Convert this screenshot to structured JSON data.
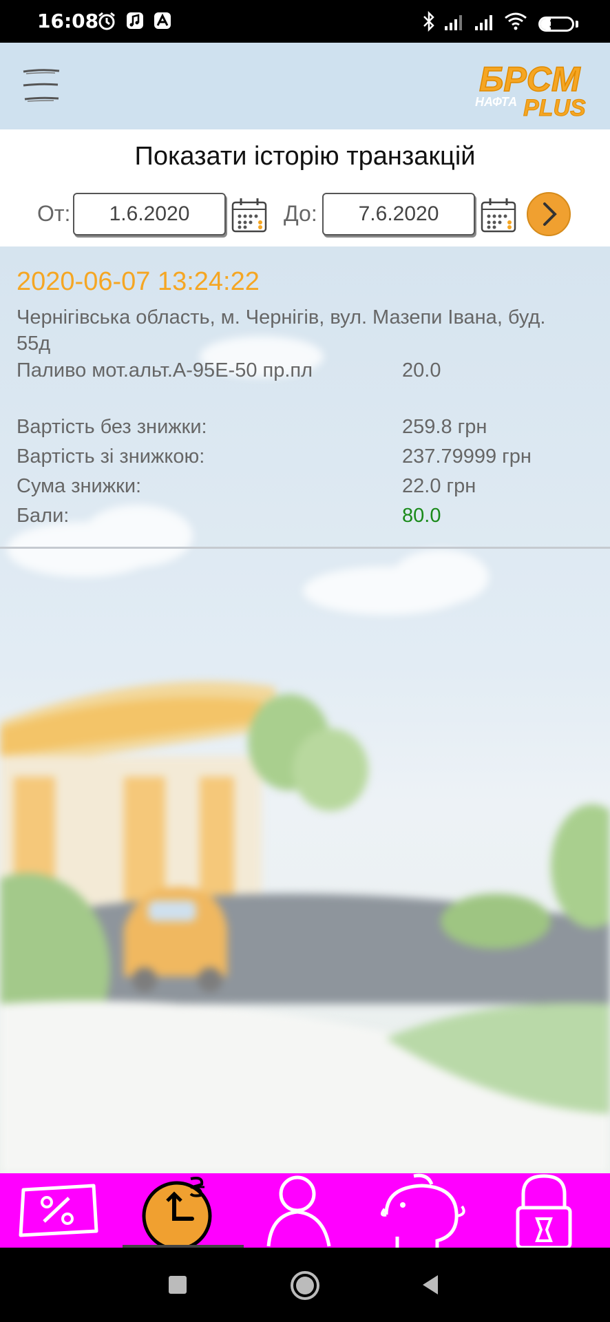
{
  "status_bar": {
    "time": "16:08",
    "battery": "33",
    "battery_level": 0.33,
    "icons": [
      "alarm-icon",
      "music-app-icon",
      "app-icon",
      "bluetooth-icon",
      "signal-icon",
      "signal-icon",
      "wifi-icon",
      "battery-icon"
    ]
  },
  "header": {
    "menu_icon": "hamburger-menu-icon",
    "logo_text_main": "БРСМ",
    "logo_text_small": "НАФТА",
    "logo_text_plus": "PLUS"
  },
  "filter": {
    "title": "Показати історію транзакцій",
    "from_label": "От:",
    "from_value": "1.6.2020",
    "to_label": "До:",
    "to_value": "7.6.2020",
    "calendar_icon": "calendar-icon",
    "submit_icon": "chevron-right-icon"
  },
  "transaction": {
    "datetime": "2020-06-07 13:24:22",
    "address": "Чернігівська область, м. Чернігів, вул. Мазепи Івана, буд. 55д",
    "fuel_name": "Паливо мот.альт.А-95Е-50 пр.пл",
    "fuel_qty": "20.0",
    "rows": [
      {
        "label": "Вартість без знижки:",
        "value": "259.8 грн"
      },
      {
        "label": "Вартість зі знижкою:",
        "value": "237.79999 грн"
      },
      {
        "label": "Сума знижки:",
        "value": "22.0 грн"
      },
      {
        "label": "Бали:",
        "value": "80.0"
      }
    ]
  },
  "colors": {
    "accent_orange": "#f5a623",
    "header_bg": "#cfe1ef",
    "nav_bg": "#ff00ff",
    "points_green": "#1a8a1a"
  },
  "bottom_nav": [
    {
      "icon": "discount-coupon-icon",
      "active": false
    },
    {
      "icon": "history-clock-icon",
      "active": true
    },
    {
      "icon": "profile-icon",
      "active": false
    },
    {
      "icon": "piggy-bank-icon",
      "active": false
    },
    {
      "icon": "lock-icon",
      "active": false
    }
  ],
  "system_nav": [
    "recents-square-icon",
    "home-circle-icon",
    "back-triangle-icon"
  ]
}
